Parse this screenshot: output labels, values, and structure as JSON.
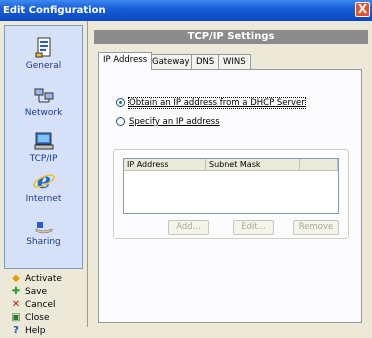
{
  "window": {
    "title": "Edit Configuration",
    "close_glyph": "X"
  },
  "sidebar": {
    "nav": [
      {
        "label": "General",
        "icon": "document-icon"
      },
      {
        "label": "Network",
        "icon": "network-icon"
      },
      {
        "label": "TCP/IP",
        "icon": "computer-icon"
      },
      {
        "label": "Internet",
        "icon": "internet-explorer-icon"
      },
      {
        "label": "Sharing",
        "icon": "sharing-hand-icon"
      }
    ],
    "actions": [
      {
        "label": "Activate",
        "icon": "activate-icon"
      },
      {
        "label": "Save",
        "icon": "save-icon"
      },
      {
        "label": "Cancel",
        "icon": "cancel-icon"
      },
      {
        "label": "Close",
        "icon": "close-icon"
      },
      {
        "label": "Help",
        "icon": "help-icon"
      }
    ]
  },
  "main": {
    "header": "TCP/IP Settings",
    "tabs": [
      "IP Address",
      "Gateway",
      "DNS",
      "WINS"
    ],
    "active_tab": "IP Address",
    "dhcp_option": "Obtain an IP address from a DHCP Server",
    "specify_option": "Specify an IP address",
    "selected_option": "dhcp",
    "table_headers": [
      "IP Address",
      "Subnet Mask"
    ],
    "buttons": {
      "add": "Add...",
      "edit": "Edit...",
      "remove": "Remove"
    }
  },
  "colors": {
    "title_bar": "#0a47c4",
    "nav_panel": "#d6e0f6",
    "header_bar": "#8c8c8c"
  }
}
